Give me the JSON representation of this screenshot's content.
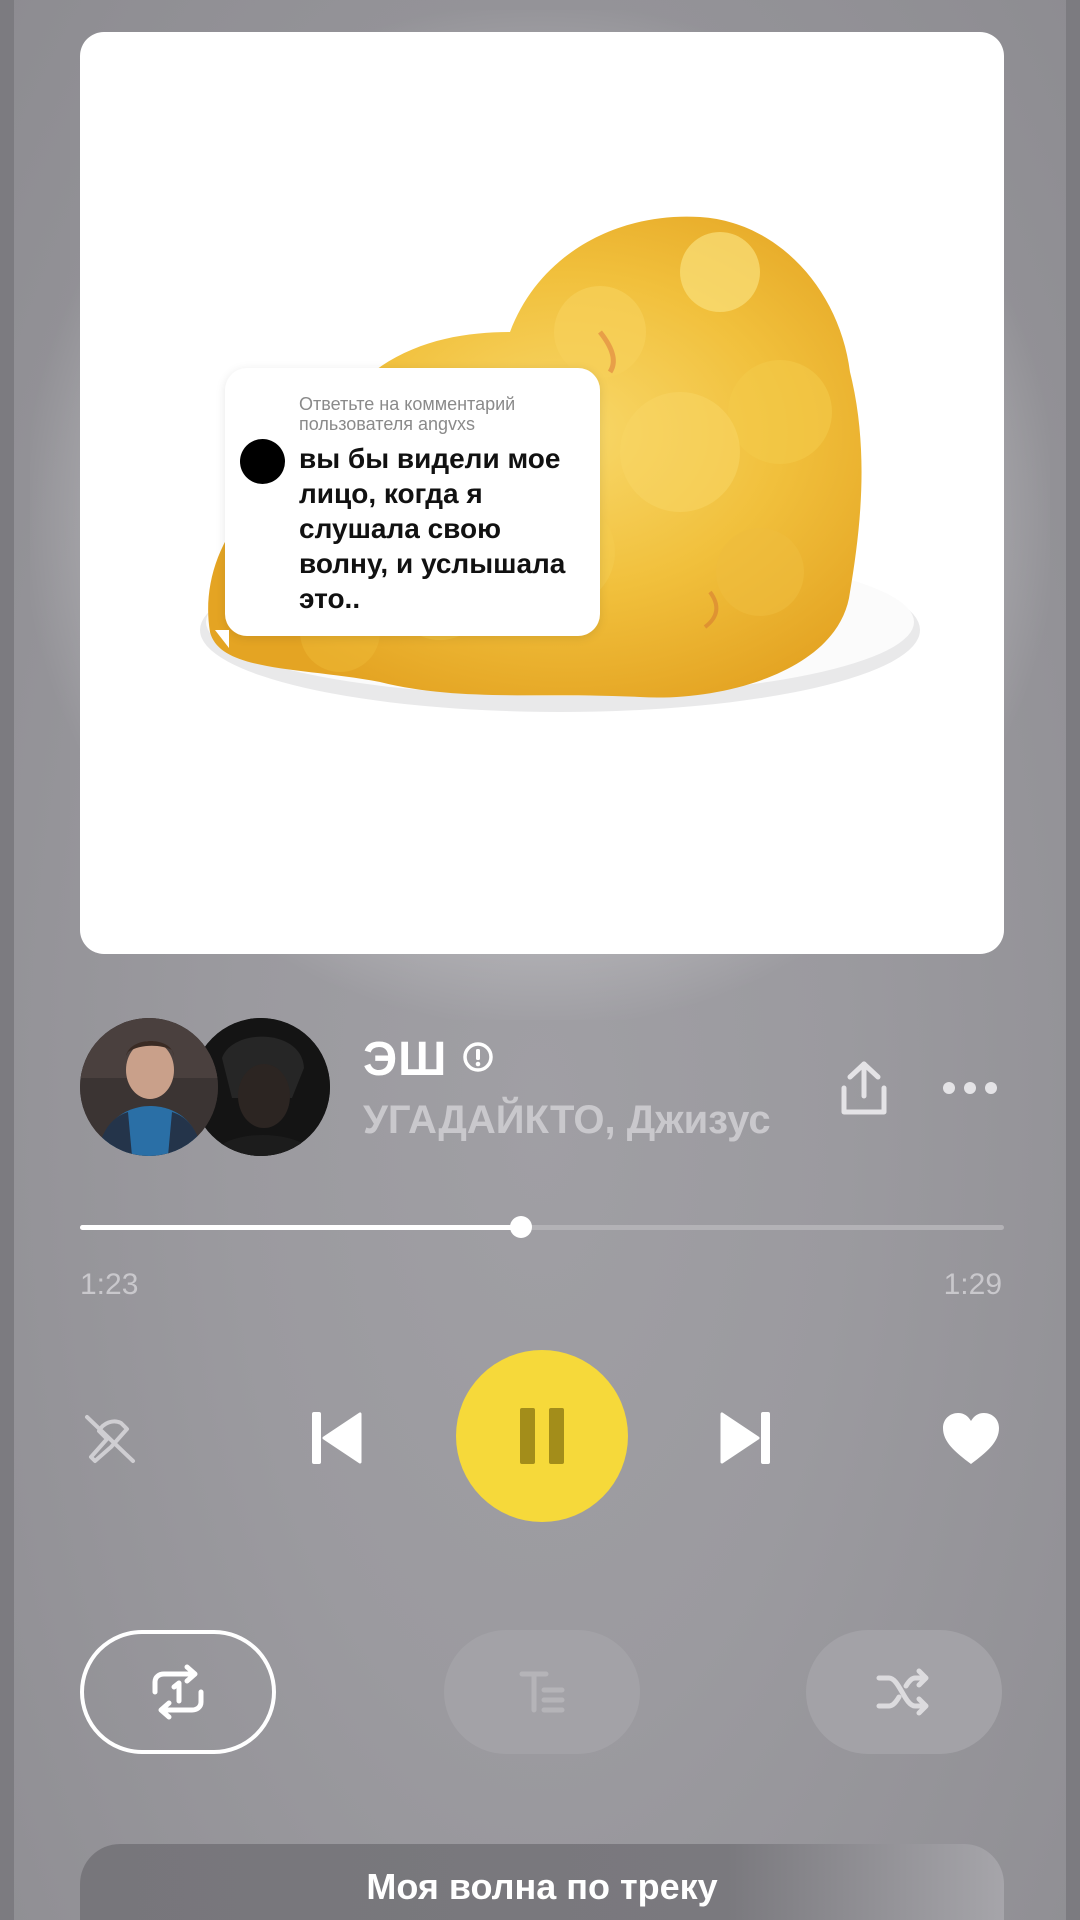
{
  "cover": {
    "comment": {
      "header": "Ответьте на комментарий пользователя angvxs",
      "text": "вы бы видели мое лицо, когда я слушала свою волну, и услышала это.."
    }
  },
  "track": {
    "title": "ЭШ",
    "artists": "УГАДАЙКТО, Джизус",
    "explicit_icon": "explicit-icon"
  },
  "progress": {
    "current": "1:23",
    "total": "1:29",
    "fraction": 0.477
  },
  "controls": {
    "dislike_icon": "dislike-icon",
    "prev_icon": "previous-icon",
    "play_state": "pause",
    "next_icon": "next-icon",
    "like_icon": "heart-icon"
  },
  "bottom": {
    "repeat_icon": "repeat-one-icon",
    "lyrics_icon": "lyrics-icon",
    "shuffle_icon": "shuffle-icon",
    "wave_label": "Моя волна по треку"
  },
  "colors": {
    "accent": "#f6d93a",
    "background": "#9b9a9f"
  }
}
